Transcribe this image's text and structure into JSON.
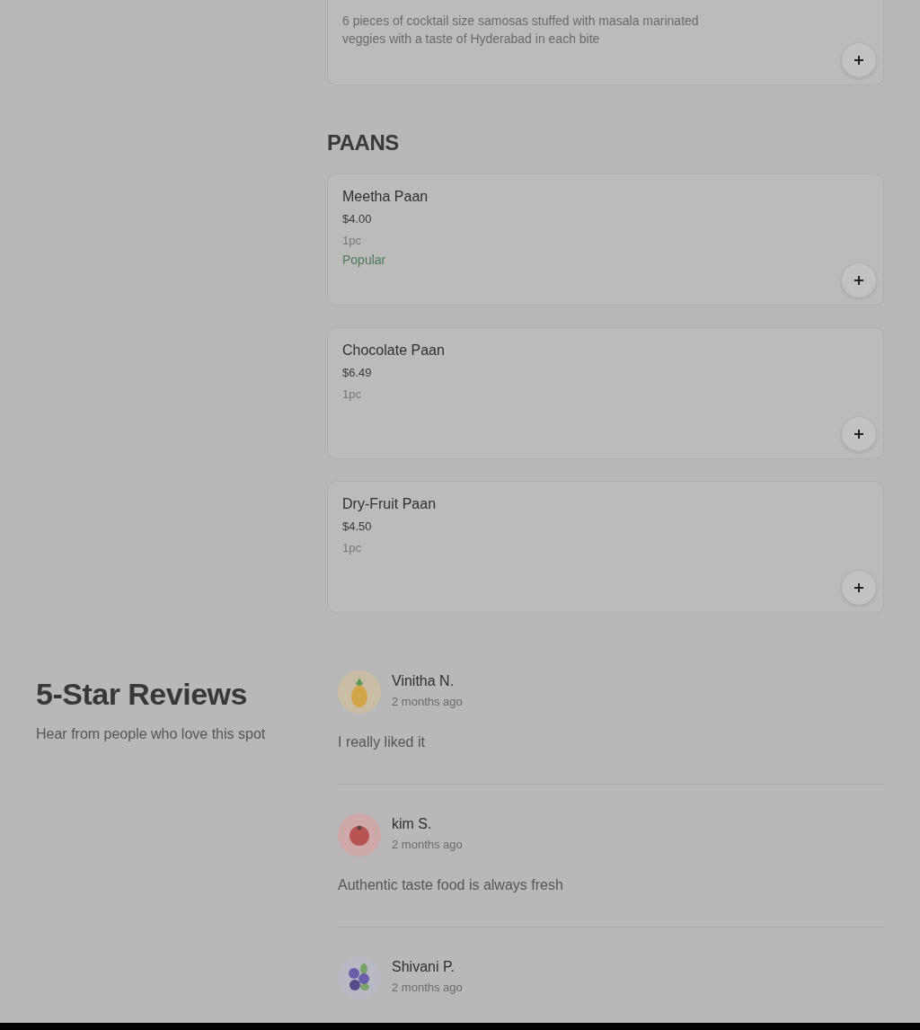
{
  "previous_item": {
    "description": "6 pieces of cocktail size samosas stuffed with masala marinated veggies with a taste of Hyderabad in each bite"
  },
  "section": {
    "title": "PAANS",
    "items": [
      {
        "name": "Meetha Paan",
        "price": "$4.00",
        "note": "1pc",
        "badge": "Popular"
      },
      {
        "name": "Chocolate Paan",
        "price": "$6.49",
        "note": "1pc"
      },
      {
        "name": "Dry-Fruit Paan",
        "price": "$4.50",
        "note": "1pc"
      }
    ]
  },
  "reviews": {
    "title": "5-Star Reviews",
    "subtitle": "Hear from people who love this spot",
    "items": [
      {
        "name": "Vinitha N.",
        "time": "2 months ago",
        "text": "I really liked it"
      },
      {
        "name": "kim S.",
        "time": "2 months ago",
        "text": "Authentic taste food is always fresh"
      },
      {
        "name": "Shivani P.",
        "time": "2 months ago"
      }
    ]
  }
}
